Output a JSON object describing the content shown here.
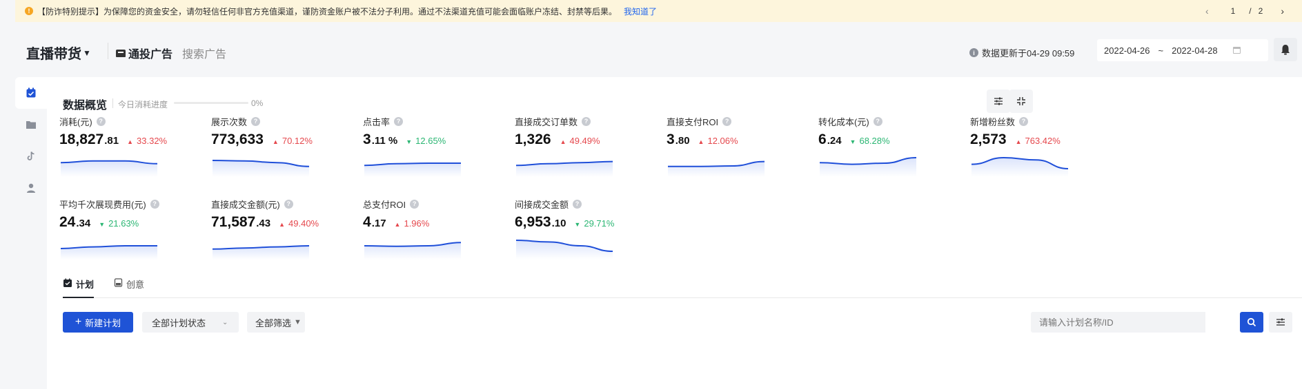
{
  "notice": {
    "text": "【防诈特别提示】为保障您的资金安全，请勿轻信任何非官方充值渠道，谨防资金账户被不法分子利用。通过不法渠道充值可能会面临账户冻结、封禁等后果。",
    "ack": "我知道了",
    "page_current": "1",
    "page_sep": "/",
    "page_total": "2"
  },
  "header": {
    "title": "直播带货",
    "tabs": [
      "通投广告",
      "搜索广告"
    ],
    "update_text": "数据更新于04-29 09:59",
    "date_start": "2022-04-26",
    "date_sep": "~",
    "date_end": "2022-04-28"
  },
  "overview": {
    "title": "数据概览",
    "progress_label": "今日消耗进度",
    "progress_pct": "0%",
    "progress_value": 0
  },
  "metrics": [
    {
      "label": "消耗(元)",
      "int": "18,827",
      "dec": ".81",
      "change": "33.32%",
      "dir": "up",
      "trend": [
        0.45,
        0.3,
        0.3,
        0.55
      ]
    },
    {
      "label": "展示次数",
      "int": "773,633",
      "dec": "",
      "change": "70.12%",
      "dir": "up",
      "trend": [
        0.25,
        0.3,
        0.45,
        0.8
      ]
    },
    {
      "label": "点击率",
      "int": "3",
      "dec": ".11 %",
      "change": "12.65%",
      "dir": "down",
      "trend": [
        0.7,
        0.55,
        0.5,
        0.5
      ]
    },
    {
      "label": "直接成交订单数",
      "int": "1,326",
      "dec": "",
      "change": "49.49%",
      "dir": "up",
      "trend": [
        0.7,
        0.55,
        0.45,
        0.35
      ]
    },
    {
      "label": "直接支付ROI",
      "int": "3",
      "dec": ".80",
      "change": "12.06%",
      "dir": "up",
      "trend": [
        0.8,
        0.8,
        0.75,
        0.35
      ]
    },
    {
      "label": "转化成本(元)",
      "int": "6",
      "dec": ".24",
      "change": "68.28%",
      "dir": "down",
      "trend": [
        0.45,
        0.6,
        0.5,
        0.0
      ]
    },
    {
      "label": "新增粉丝数",
      "int": "2,573",
      "dec": "",
      "change": "763.42%",
      "dir": "up",
      "trend": [
        0.6,
        0.0,
        0.2,
        1.0
      ]
    },
    {
      "label": "平均千次展现费用(元)",
      "int": "24",
      "dec": ".34",
      "change": "21.63%",
      "dir": "down",
      "trend": [
        0.75,
        0.6,
        0.5,
        0.5
      ]
    },
    {
      "label": "直接成交金额(元)",
      "int": "71,587",
      "dec": ".43",
      "change": "49.40%",
      "dir": "up",
      "trend": [
        0.8,
        0.7,
        0.6,
        0.5
      ]
    },
    {
      "label": "总支付ROI",
      "int": "4",
      "dec": ".17",
      "change": "1.96%",
      "dir": "up",
      "trend": [
        0.5,
        0.55,
        0.5,
        0.2
      ]
    },
    {
      "label": "间接成交金额",
      "int": "6,953",
      "dec": ".10",
      "change": "29.71%",
      "dir": "down",
      "trend": [
        0.0,
        0.15,
        0.5,
        1.0
      ]
    }
  ],
  "bottom_tabs": [
    "计划",
    "创意"
  ],
  "toolbar": {
    "new_plan": "新建计划",
    "status_filter": "全部计划状态",
    "filter_all": "全部筛选",
    "search_placeholder": "请输入计划名称/ID"
  },
  "colors": {
    "accent": "#1f53d6",
    "up": "#e5484d",
    "down": "#2bb673",
    "sparkline": "#1f4fd9",
    "notice_bg": "#fdf5dc"
  },
  "icons": [
    "warning-icon",
    "chevron-left-icon",
    "chevron-right-icon",
    "caret-down-icon",
    "ad-icon",
    "info-icon",
    "calendar-icon",
    "bell-icon",
    "calendar-check-icon",
    "folder-icon",
    "tiktok-icon",
    "user-icon",
    "filter-settings-icon",
    "collapse-icon",
    "help-icon",
    "plan-icon",
    "creative-icon",
    "plus-icon",
    "search-icon",
    "settings-icon"
  ]
}
